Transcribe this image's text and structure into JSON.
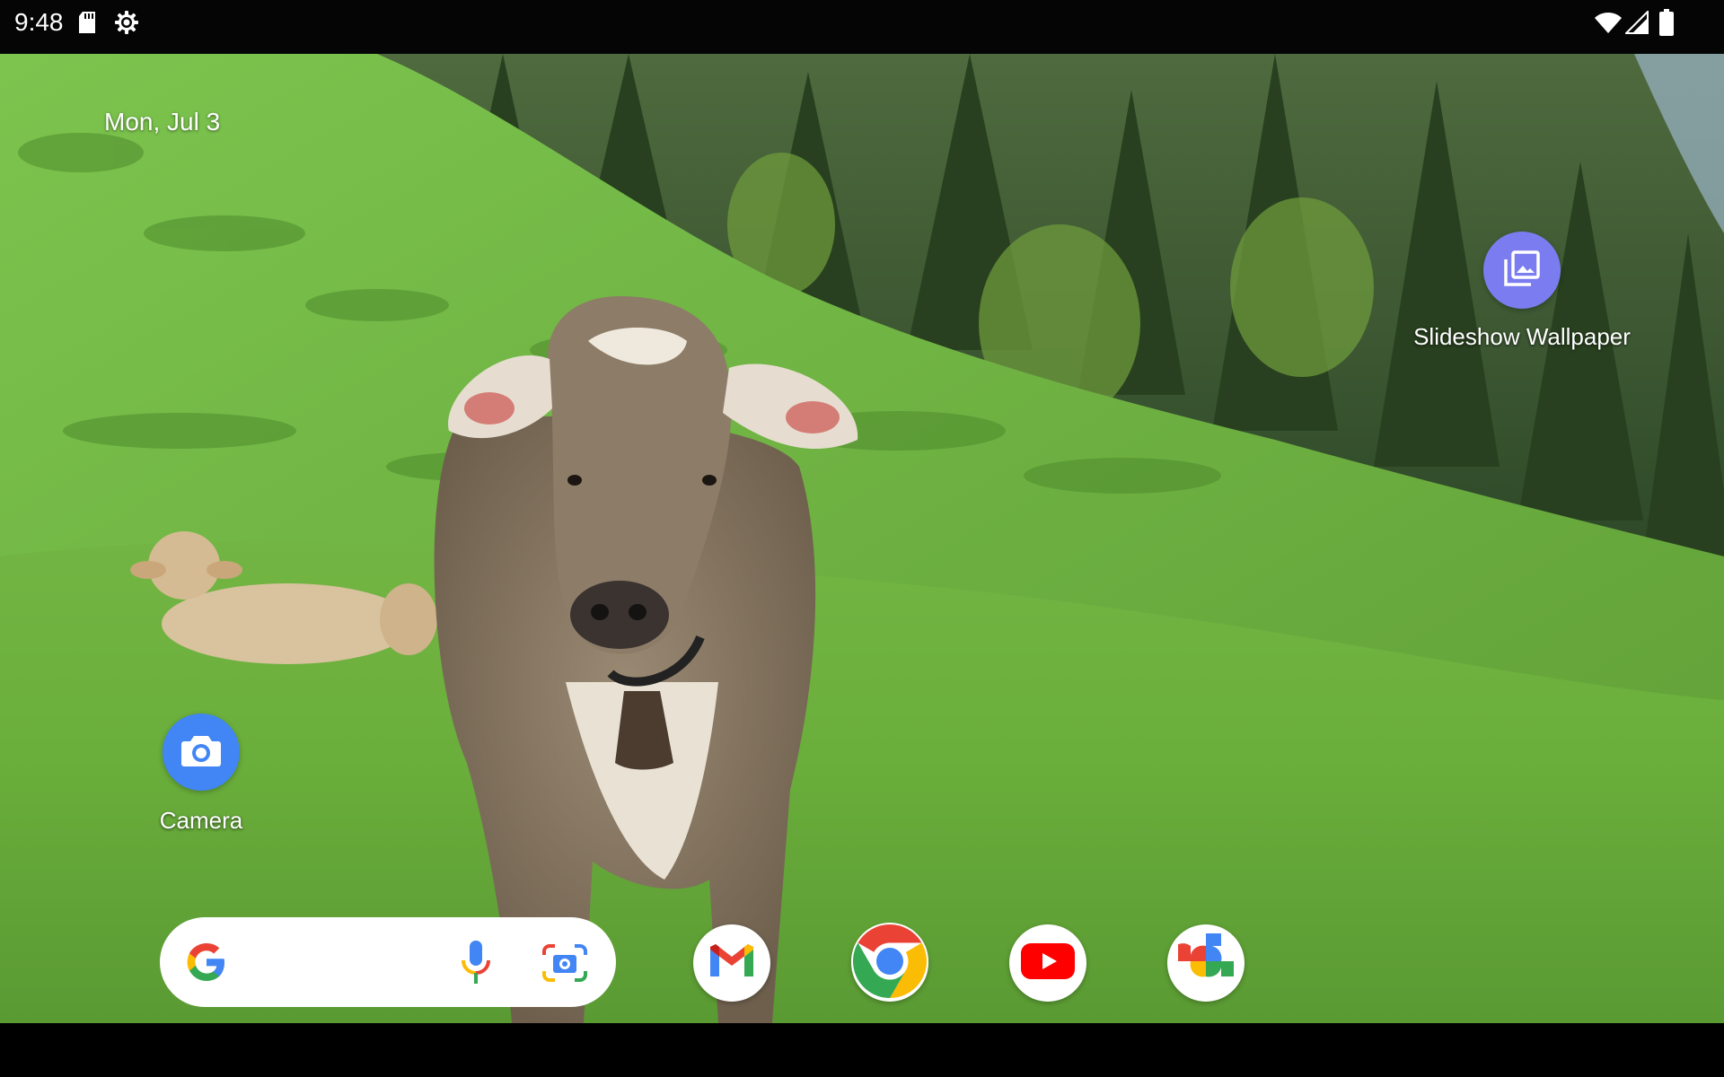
{
  "status_bar": {
    "time": "9:48",
    "left_icons": [
      "sd-card-icon",
      "settings-gear-icon"
    ],
    "right_icons": [
      "wifi-icon",
      "cell-signal-icon",
      "battery-icon"
    ]
  },
  "wallpaper": {
    "subject": "wallpaper-cow-pasture"
  },
  "home": {
    "date": "Mon, Jul 3",
    "apps": [
      {
        "label": "Camera",
        "icon": "camera-icon",
        "color": "#4285F4"
      },
      {
        "label": "Slideshow Wallpaper",
        "icon": "image-stack-icon",
        "color": "#7B7CF0"
      }
    ]
  },
  "search_bar": {
    "icons": [
      "google-g-icon",
      "microphone-icon",
      "google-lens-icon"
    ]
  },
  "dock": {
    "apps": [
      {
        "icon": "gmail-icon"
      },
      {
        "icon": "chrome-icon"
      },
      {
        "icon": "youtube-icon"
      },
      {
        "icon": "google-photos-icon"
      }
    ]
  }
}
